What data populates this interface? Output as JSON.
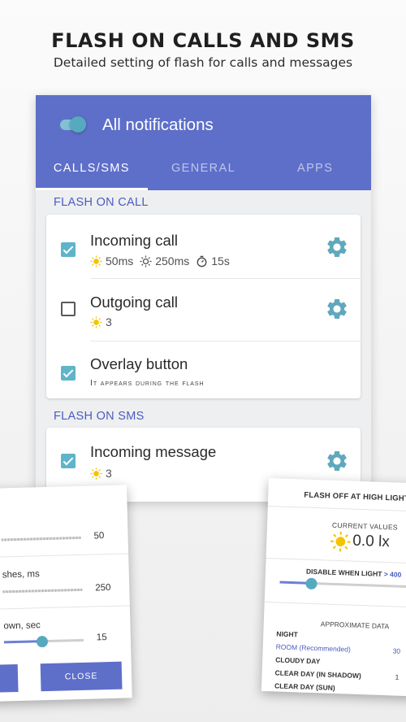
{
  "promo": {
    "title": "FLASH ON CALLS AND SMS",
    "subtitle": "Detailed setting of flash for calls and messages"
  },
  "colors": {
    "primary": "#5e6fc9",
    "accent": "#5fb4c9",
    "section_header": "#4a5cc0",
    "icon_sun": "#f5c400"
  },
  "appbar": {
    "toggle_on": true,
    "title": "All notifications"
  },
  "tabs": [
    {
      "label": "CALLS/SMS",
      "active": true
    },
    {
      "label": "GENERAL",
      "active": false
    },
    {
      "label": "APPS",
      "active": false
    }
  ],
  "sections": {
    "call": {
      "header": "FLASH ON CALL",
      "items": [
        {
          "title": "Incoming call",
          "checked": true,
          "on_ms": "50ms",
          "off_ms": "250ms",
          "duration": "15s"
        },
        {
          "title": "Outgoing call",
          "checked": false,
          "count": "3"
        },
        {
          "title": "Overlay button",
          "checked": true,
          "description": "It appears during the flash"
        }
      ]
    },
    "sms": {
      "header": "FLASH ON SMS",
      "items": [
        {
          "title": "Incoming message",
          "checked": true,
          "count": "3"
        }
      ]
    }
  },
  "dialog_left": {
    "rows": [
      {
        "label": "",
        "value": "50"
      },
      {
        "label": "shes, ms",
        "value": "250"
      },
      {
        "label": "own, sec",
        "value": "15"
      }
    ],
    "close_label": "CLOSE"
  },
  "dialog_right": {
    "title": "FLASH OFF AT HIGH LIGHT S",
    "current_label": "CURRENT VALUES",
    "current_value": "0.0 lx",
    "disable_label": "DISABLE WHEN LIGHT",
    "disable_threshold": "> 400",
    "approx_label": "APPROXIMATE DATA",
    "conditions": [
      {
        "name": "NIGHT",
        "value": ""
      },
      {
        "name": "ROOM (Recommended)",
        "value": "30"
      },
      {
        "name": "CLOUDY DAY",
        "value": ""
      },
      {
        "name": "CLEAR DAY (IN SHADOW)",
        "value": "1"
      },
      {
        "name": "CLEAR DAY (SUN)",
        "value": ""
      }
    ]
  }
}
